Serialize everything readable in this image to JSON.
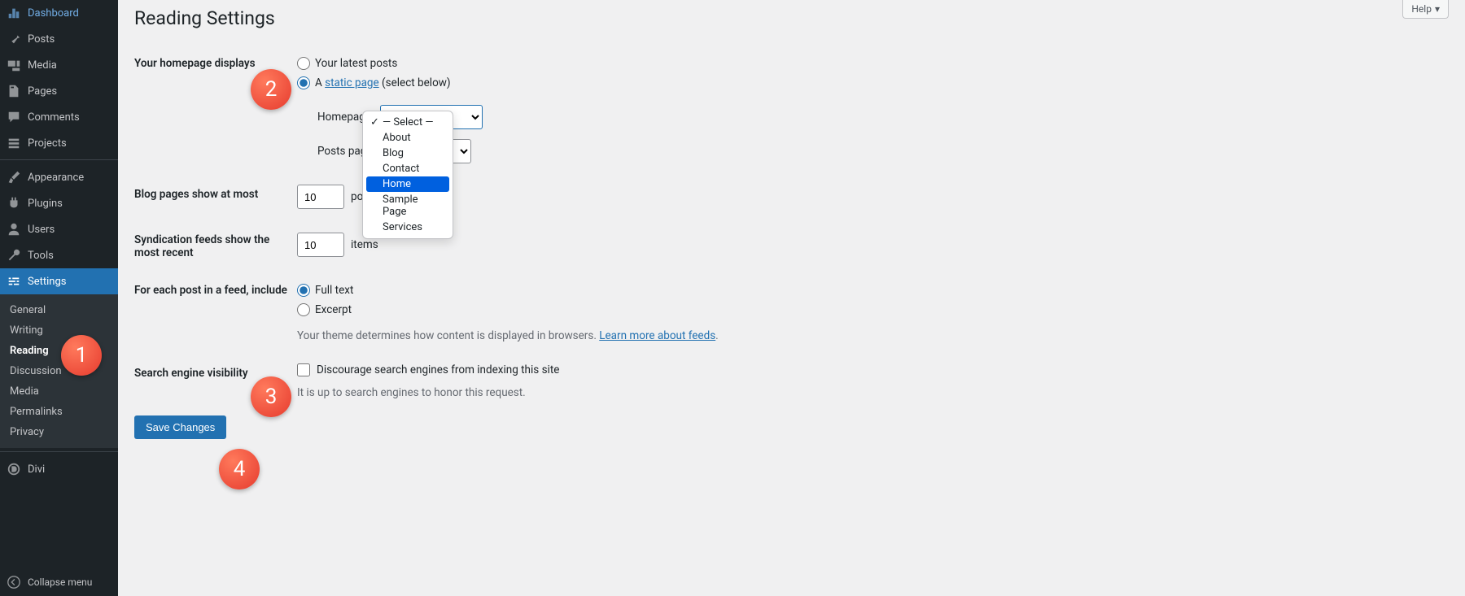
{
  "sidebar": {
    "items": [
      {
        "label": "Dashboard"
      },
      {
        "label": "Posts"
      },
      {
        "label": "Media"
      },
      {
        "label": "Pages"
      },
      {
        "label": "Comments"
      },
      {
        "label": "Projects"
      },
      {
        "label": "Appearance"
      },
      {
        "label": "Plugins"
      },
      {
        "label": "Users"
      },
      {
        "label": "Tools"
      },
      {
        "label": "Settings"
      }
    ],
    "submenu": [
      {
        "label": "General"
      },
      {
        "label": "Writing"
      },
      {
        "label": "Reading"
      },
      {
        "label": "Discussion"
      },
      {
        "label": "Media"
      },
      {
        "label": "Permalinks"
      },
      {
        "label": "Privacy"
      }
    ],
    "divi": "Divi",
    "collapse": "Collapse menu"
  },
  "help_label": "Help",
  "page_title": "Reading Settings",
  "homepage_displays": {
    "label": "Your homepage displays",
    "opt_latest": "Your latest posts",
    "opt_static_prefix": "A ",
    "opt_static_link": "static page",
    "opt_static_suffix": " (select below)",
    "homepage_label": "Homepage:",
    "posts_page_label": "Posts page:"
  },
  "select_popup": {
    "options": [
      "— Select —",
      "About",
      "Blog",
      "Contact",
      "Home",
      "Sample Page",
      "Services"
    ],
    "highlighted_index": 4,
    "checked_index": 0
  },
  "blog_pages": {
    "label": "Blog pages show at most",
    "value": "10",
    "suffix": "posts"
  },
  "syndication": {
    "label": "Syndication feeds show the most recent",
    "value": "10",
    "suffix": "items"
  },
  "feed_format": {
    "label": "For each post in a feed, include",
    "opt_full": "Full text",
    "opt_excerpt": "Excerpt",
    "note_prefix": "Your theme determines how content is displayed in browsers. ",
    "note_link": "Learn more about feeds",
    "note_suffix": "."
  },
  "search_engine": {
    "label": "Search engine visibility",
    "checkbox_label": "Discourage search engines from indexing this site",
    "note": "It is up to search engines to honor this request."
  },
  "save_label": "Save Changes",
  "badges": {
    "b1": "1",
    "b2": "2",
    "b3": "3",
    "b4": "4"
  }
}
